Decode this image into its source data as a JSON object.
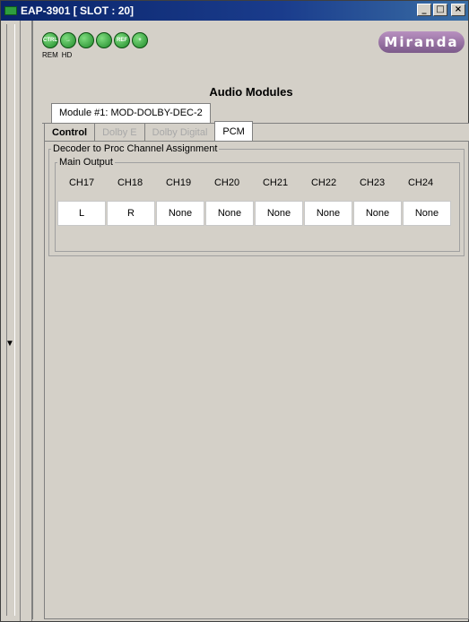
{
  "window": {
    "title": "EAP-3901 [ SLOT : 20]"
  },
  "toolbar": {
    "icons": [
      "CTRL",
      "",
      "",
      "",
      "REF",
      ""
    ],
    "sub_left": "REM",
    "sub_right": "HD"
  },
  "logo": "Miranda",
  "page": {
    "title": "Audio Modules"
  },
  "module_tab": "Module #1: MOD-DOLBY-DEC-2",
  "subtabs": [
    {
      "label": "Control",
      "state": "normal"
    },
    {
      "label": "Dolby E",
      "state": "disabled"
    },
    {
      "label": "Dolby Digital",
      "state": "disabled"
    },
    {
      "label": "PCM",
      "state": "active"
    }
  ],
  "groups": {
    "outer_label": "Decoder to Proc Channel Assignment",
    "inner_label": "Main Output"
  },
  "channels": {
    "headers": [
      "CH17",
      "CH18",
      "CH19",
      "CH20",
      "CH21",
      "CH22",
      "CH23",
      "CH24"
    ],
    "values": [
      "L",
      "R",
      "None",
      "None",
      "None",
      "None",
      "None",
      "None"
    ]
  }
}
